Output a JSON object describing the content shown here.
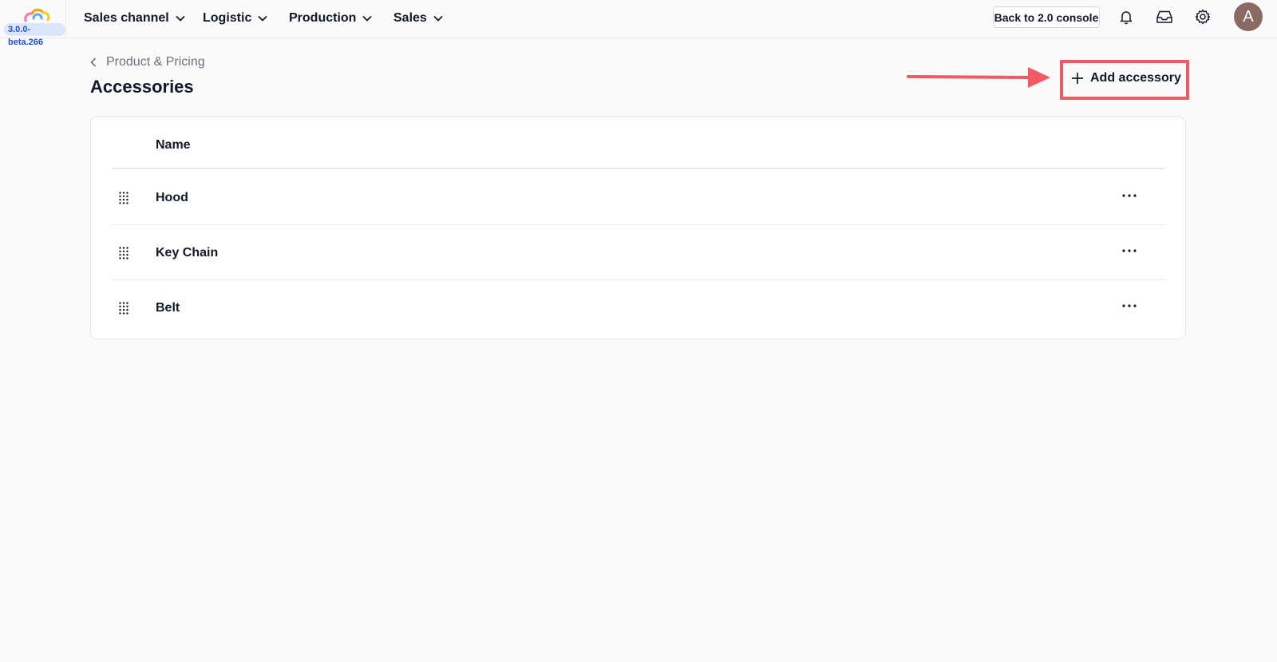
{
  "app": {
    "version": "3.0.0-beta.266",
    "brand_colors": [
      "#f472b6",
      "#facc15",
      "#60a5fa"
    ]
  },
  "nav": {
    "items": [
      {
        "label": "Sales channel",
        "icon": "chevron-down-icon"
      },
      {
        "label": "Logistic",
        "icon": "chevron-down-icon"
      },
      {
        "label": "Production",
        "icon": "chevron-down-icon"
      },
      {
        "label": "Sales",
        "icon": "chevron-down-icon"
      }
    ],
    "console_button": "Back to 2.0 console",
    "icons": [
      "bell-icon",
      "inbox-icon",
      "gear-icon"
    ],
    "avatar_initial": "A"
  },
  "page": {
    "breadcrumb": "Product & Pricing",
    "title": "Accessories",
    "add_button": "Add accessory",
    "highlight_color": "#ef5a63"
  },
  "table": {
    "columns": [
      "Name"
    ],
    "rows": [
      {
        "name": "Hood"
      },
      {
        "name": "Key Chain"
      },
      {
        "name": "Belt"
      }
    ]
  }
}
